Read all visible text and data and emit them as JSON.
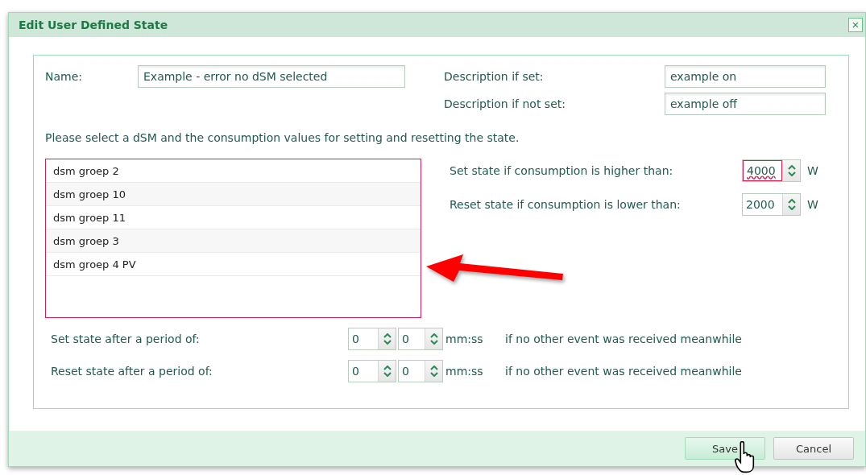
{
  "dialog": {
    "title": "Edit User Defined State",
    "close": "×"
  },
  "name": {
    "label": "Name:",
    "value": "Example - error no dSM selected"
  },
  "descriptions": [
    {
      "label": "Description if set:",
      "value": "example on"
    },
    {
      "label": "Description if not set:",
      "value": "example off"
    }
  ],
  "instruction": "Please select a dSM and the consumption values for setting and resetting the state.",
  "dsm_list": {
    "invalid": true,
    "items": [
      {
        "label": "dsm groep 2",
        "selected": false
      },
      {
        "label": "dsm groep 10",
        "selected": false
      },
      {
        "label": "dsm groep 11",
        "selected": false
      },
      {
        "label": "dsm groep 3",
        "selected": false
      },
      {
        "label": "dsm groep 4 PV",
        "selected": false
      }
    ]
  },
  "thresholds": [
    {
      "label": "Set state if consumption is higher than:",
      "value": "4000",
      "unit": "W",
      "invalid": true
    },
    {
      "label": "Reset state if consumption is lower than:",
      "value": "2000",
      "unit": "W",
      "invalid": false
    }
  ],
  "periods": [
    {
      "label": "Set state after a period of:",
      "minutes": "0",
      "seconds": "0",
      "unit": "mm:ss",
      "note": "if no other event was received meanwhile"
    },
    {
      "label": "Reset state after a period of:",
      "minutes": "0",
      "seconds": "0",
      "unit": "mm:ss",
      "note": "if no other event was received meanwhile"
    }
  ],
  "buttons": [
    {
      "label": "Save",
      "hovered": true
    },
    {
      "label": "Cancel",
      "hovered": false
    }
  ]
}
